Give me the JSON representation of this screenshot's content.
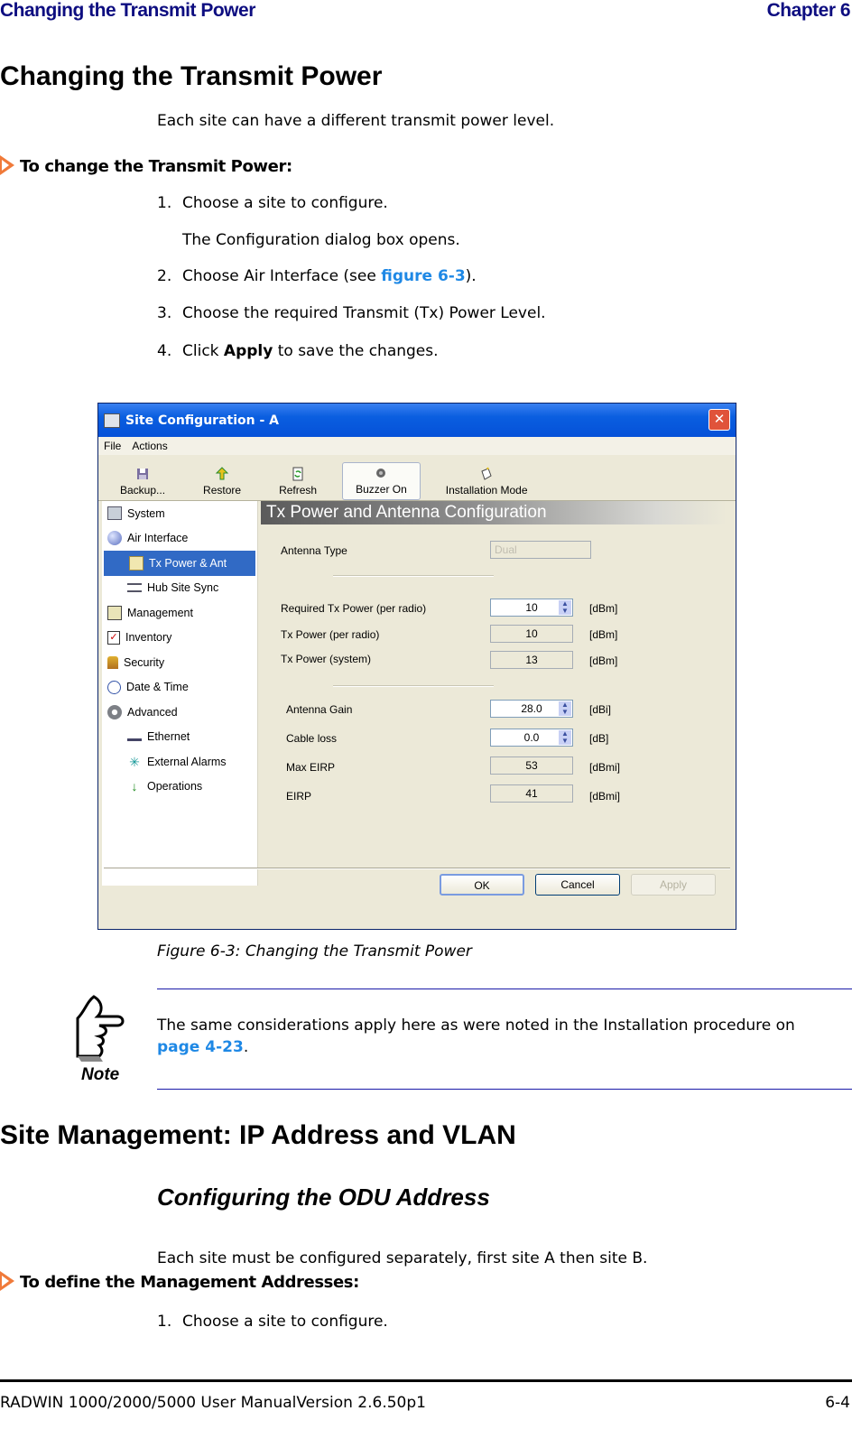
{
  "header": {
    "left": "Changing the Transmit Power",
    "right": "Chapter 6"
  },
  "section1": {
    "title": "Changing the Transmit Power",
    "intro": "Each site can have a different transmit power level.",
    "procedure_title": "To change the Transmit Power:",
    "steps": [
      {
        "num": "1.",
        "text": "Choose a site to configure."
      },
      {
        "num": "",
        "text": "The Configuration dialog box opens."
      },
      {
        "num": "2.",
        "pre": "Choose Air Interface (see ",
        "link": "figure 6-3",
        "post": ")."
      },
      {
        "num": "3.",
        "text": "Choose the required Transmit (Tx) Power Level."
      },
      {
        "num": "4.",
        "pre": "Click ",
        "bold": "Apply",
        "post": " to save the changes."
      }
    ]
  },
  "dialog": {
    "title": "Site Configuration - A",
    "close_glyph": "✕",
    "menu": [
      "File",
      "Actions"
    ],
    "toolbar": [
      {
        "label": "Backup...",
        "icon": "save-icon"
      },
      {
        "label": "Restore",
        "icon": "restore-icon"
      },
      {
        "label": "Refresh",
        "icon": "refresh-icon"
      },
      {
        "label": "Buzzer On",
        "icon": "buzzer-icon"
      },
      {
        "label": "Installation Mode",
        "icon": "installation-icon"
      }
    ],
    "nav": [
      {
        "label": "System",
        "icon": "system-icon"
      },
      {
        "label": "Air Interface",
        "icon": "air-interface-icon"
      },
      {
        "label": "Tx Power & Ant",
        "icon": "tx-power-icon",
        "selected": true
      },
      {
        "label": "Hub Site Sync",
        "icon": "hub-sync-icon"
      },
      {
        "label": "Management",
        "icon": "management-icon"
      },
      {
        "label": "Inventory",
        "icon": "inventory-icon"
      },
      {
        "label": "Security",
        "icon": "security-icon"
      },
      {
        "label": "Date & Time",
        "icon": "clock-icon"
      },
      {
        "label": "Advanced",
        "icon": "gear-icon"
      },
      {
        "label": "Ethernet",
        "icon": "ethernet-icon"
      },
      {
        "label": "External Alarms",
        "icon": "alarm-icon"
      },
      {
        "label": "Operations",
        "icon": "operations-icon"
      }
    ],
    "panel_title": "Tx Power and Antenna Configuration",
    "antenna_type": {
      "label": "Antenna Type",
      "value": "Dual"
    },
    "fields": [
      {
        "label": "Required Tx Power (per radio)",
        "value": "10",
        "unit": "[dBm]",
        "editable": true
      },
      {
        "label": "Tx Power (per radio)",
        "value": "10",
        "unit": "[dBm]",
        "editable": false
      },
      {
        "label": "Tx Power (system)",
        "value": "13",
        "unit": "[dBm]",
        "editable": false
      },
      {
        "label": "Antenna Gain",
        "value": "28.0",
        "unit": "[dBi]",
        "editable": true
      },
      {
        "label": "Cable loss",
        "value": "0.0",
        "unit": "[dB]",
        "editable": true
      },
      {
        "label": "Max EIRP",
        "value": "53",
        "unit": "[dBmi]",
        "editable": false
      },
      {
        "label": "EIRP",
        "value": "41",
        "unit": "[dBmi]",
        "editable": false
      }
    ],
    "buttons": {
      "ok": "OK",
      "cancel": "Cancel",
      "apply": "Apply"
    }
  },
  "figure_caption": "Figure 6-3: Changing the Transmit Power",
  "note": {
    "label": "Note",
    "text_pre": "The same considerations apply here as were noted in the Installation procedure on ",
    "link": "page 4-23",
    "text_post": "."
  },
  "section2": {
    "title": "Site Management: IP Address and VLAN",
    "subtitle": "Configuring the ODU Address",
    "intro": "Each site must be configured separately, first site A then site B.",
    "procedure_title": "To define the Management Addresses:",
    "steps": [
      {
        "num": "1.",
        "text": "Choose a site to configure."
      }
    ]
  },
  "footer": {
    "left": "RADWIN 1000/2000/5000 User ManualVersion  2.6.50p1",
    "right": "6-4"
  }
}
